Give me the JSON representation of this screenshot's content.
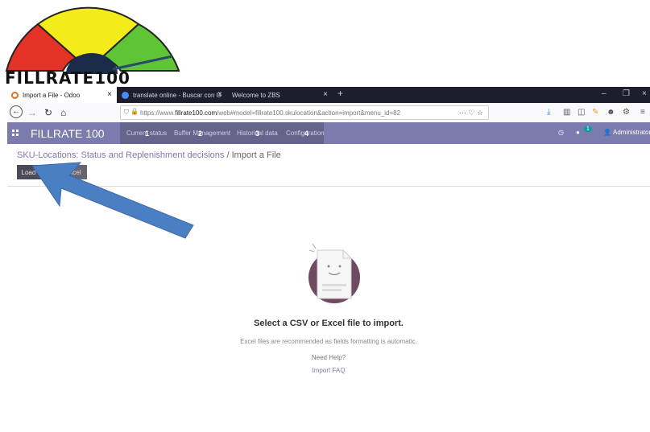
{
  "logo": {
    "text": "FILLRATE100"
  },
  "browser": {
    "tabs": [
      {
        "label": "Import a File - Odoo",
        "active": true
      },
      {
        "label": "translate online - Buscar con G",
        "active": false
      },
      {
        "label": "Welcome to ZBS",
        "active": false
      }
    ],
    "new_tab": "+",
    "url_prefix": "https://www.",
    "url_domain": "fillrate100.com",
    "url_rest": "/web#model=fillrate100.skulocation&action=import&menu_id=82"
  },
  "app": {
    "brand": "FILLRATE 100",
    "menu": [
      {
        "label": "Current status",
        "badge": "1"
      },
      {
        "label": "Buffer Management",
        "badge": "2"
      },
      {
        "label": "Historical data",
        "badge": "3"
      },
      {
        "label": "Configuration",
        "badge": "4"
      }
    ],
    "chat_count": "1",
    "user": "Administrator"
  },
  "control_panel": {
    "breadcrumb_parent": "SKU-Locations: Status and Replenishment decisions",
    "breadcrumb_sep": " / ",
    "breadcrumb_current": "Import a File",
    "load_button": "Load File",
    "cancel_button": "Cancel"
  },
  "main": {
    "heading": "Select a CSV or Excel file to import.",
    "subtext": "Excel files are recommended as fields formatting is automatic.",
    "help": "Need Help?",
    "faq": "Import FAQ"
  },
  "colors": {
    "brand": "#7c7bad",
    "gauge_red": "#e53227",
    "gauge_yellow": "#f4ec1a",
    "gauge_green": "#5fc536",
    "arrow": "#4a7fc4"
  },
  "icons": [
    "apps-grid-icon",
    "clock-icon",
    "chat-icon",
    "user-icon",
    "back-icon",
    "forward-icon",
    "reload-icon",
    "home-icon",
    "shield-icon",
    "lock-icon",
    "bookmark-star-icon"
  ]
}
